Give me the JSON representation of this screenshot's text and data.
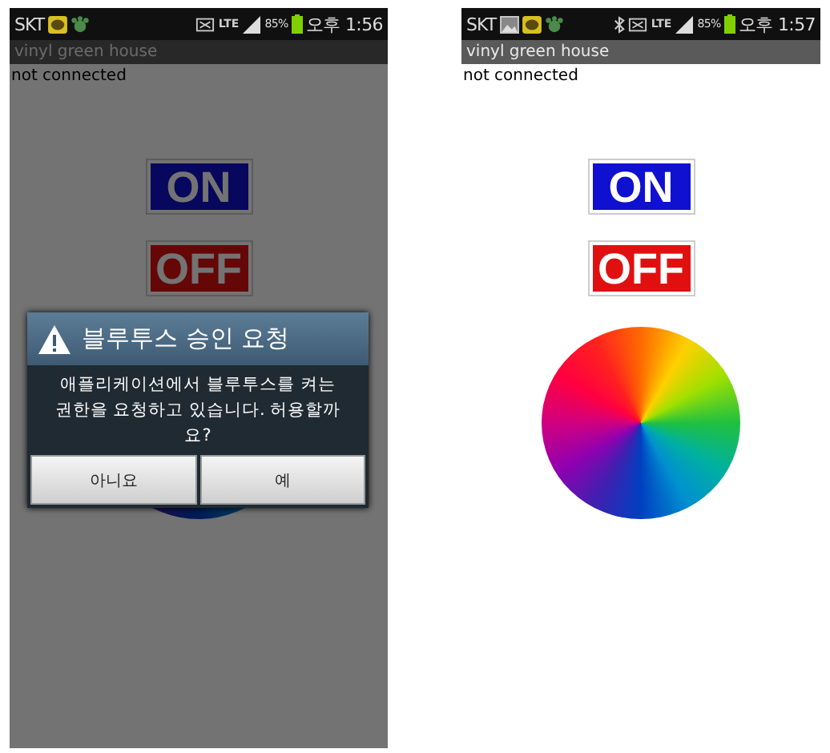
{
  "phones": [
    {
      "status_bar": {
        "carrier": "SKT",
        "notification_icons": [
          {
            "kind": "chat"
          },
          {
            "kind": "paw"
          }
        ],
        "bluetooth": false,
        "signal_label": "LTE",
        "battery": "85%",
        "time": "오후 1:56"
      },
      "app_title": "vinyl green house",
      "status_text": "not connected",
      "buttons": [
        {
          "label": "ON",
          "kind": "on"
        },
        {
          "label": "OFF",
          "kind": "off"
        }
      ],
      "dialog": {
        "title": "블루투스 승인 요청",
        "message": "애플리케이션에서 블루투스를 켜는 권한을 요청하고 있습니다. 허용할까요?",
        "buttons": [
          "아니요",
          "예"
        ]
      }
    },
    {
      "status_bar": {
        "carrier": "SKT",
        "notification_icons": [
          {
            "kind": "image"
          },
          {
            "kind": "chat"
          },
          {
            "kind": "paw"
          }
        ],
        "bluetooth": true,
        "signal_label": "LTE",
        "battery": "85%",
        "time": "오후 1:57"
      },
      "app_title": "vinyl green house",
      "status_text": "not connected",
      "buttons": [
        {
          "label": "ON",
          "kind": "on"
        },
        {
          "label": "OFF",
          "kind": "off"
        }
      ]
    }
  ]
}
